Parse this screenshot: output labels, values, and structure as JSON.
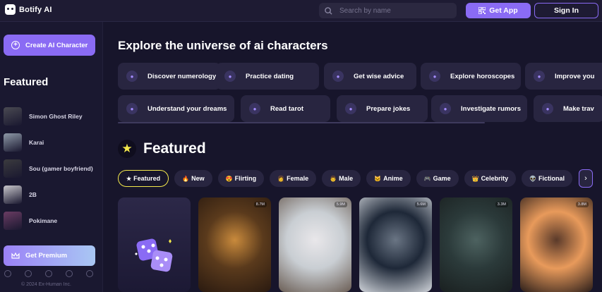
{
  "header": {
    "logo_text": "Botify AI",
    "search_placeholder": "Search by name",
    "get_app_label": "Get App",
    "sign_in_label": "Sign In"
  },
  "sidebar": {
    "create_label": "Create AI Character",
    "featured_title": "Featured",
    "items": [
      {
        "name": "Simon Ghost Riley",
        "avatar": "#4a4a52"
      },
      {
        "name": "Karai",
        "avatar": "#8f9aa8"
      },
      {
        "name": "Sou (gamer boyfriend)",
        "avatar": "#3b3b3e"
      },
      {
        "name": "2B",
        "avatar": "#c9c7cc"
      },
      {
        "name": "Pokimane",
        "avatar": "#6a3c63"
      }
    ],
    "premium_label": "Get Premium",
    "socials": [
      "facebook-icon",
      "x-icon",
      "instagram-icon",
      "discord-icon",
      "reddit-icon"
    ],
    "copyright": "© 2024 Ex-Human Inc."
  },
  "main": {
    "title": "Explore the universe of ai characters",
    "topics_row1": [
      "Discover numerology",
      "Practice dating",
      "Get wise advice",
      "Explore horoscopes",
      "Improve you"
    ],
    "topics_row2": [
      "Understand your dreams",
      "Read tarot",
      "Prepare jokes",
      "Investigate rumors",
      "Make trav"
    ],
    "section_title": "Featured",
    "tabs": [
      {
        "icon": "★",
        "label": "Featured",
        "active": true
      },
      {
        "icon": "🔥",
        "label": "New"
      },
      {
        "icon": "😍",
        "label": "Flirting"
      },
      {
        "icon": "👩",
        "label": "Female"
      },
      {
        "icon": "👨",
        "label": "Male"
      },
      {
        "icon": "🐱",
        "label": "Anime"
      },
      {
        "icon": "🎮",
        "label": "Game"
      },
      {
        "icon": "👑",
        "label": "Celebrity"
      },
      {
        "icon": "👽",
        "label": "Fictional"
      }
    ],
    "cards": [
      {
        "type": "random"
      },
      {
        "count": "8.7M",
        "palette": [
          "#5a3a1c",
          "#c98a3c",
          "#2a1a10"
        ]
      },
      {
        "count": "5.9M",
        "palette": [
          "#c9ced3",
          "#e9e7ea",
          "#6b5e55"
        ]
      },
      {
        "count": "5.6M",
        "palette": [
          "#1e2838",
          "#6a7584",
          "#cfd3d9"
        ]
      },
      {
        "count": "3.3M",
        "palette": [
          "#2b3a3a",
          "#4d6260",
          "#1a2020"
        ]
      },
      {
        "count": "3.8M",
        "palette": [
          "#e89a5b",
          "#5a3a2a",
          "#2b1e1a"
        ]
      }
    ]
  },
  "colors": {
    "accent": "#8a6bf4",
    "background": "#17152b",
    "chip": "#282540",
    "active_tab_border": "#f4e94b"
  }
}
